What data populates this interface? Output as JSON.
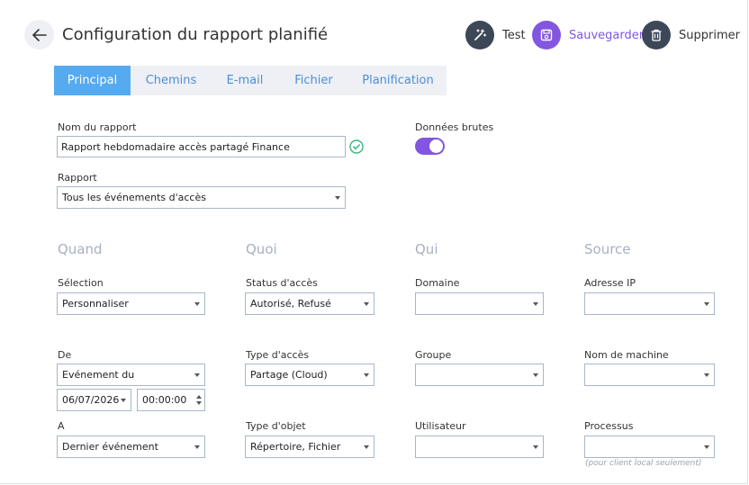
{
  "header": {
    "title": "Configuration du rapport planifié",
    "test_label": "Test",
    "save_label": "Sauvegarder",
    "delete_label": "Supprimer"
  },
  "tabs": [
    "Principal",
    "Chemins",
    "E-mail",
    "Fichier",
    "Planification"
  ],
  "form": {
    "report_name_label": "Nom du rapport",
    "report_name_value": "Rapport hebdomadaire accès partagé Finance",
    "raw_data_label": "Données brutes",
    "raw_data_on": true,
    "report_label": "Rapport",
    "report_value": "Tous les événements d'accès"
  },
  "sections": {
    "when": "Quand",
    "what": "Quoi",
    "who": "Qui",
    "source": "Source"
  },
  "quand": {
    "selection_label": "Sélection",
    "selection_value": "Personnaliser",
    "from_label": "De",
    "from_value": "Evénement du",
    "date_value": "06/07/2026",
    "time_value": "00:00:00",
    "to_label": "A",
    "to_value": "Dernier événement"
  },
  "quoi": {
    "status_label": "Status d'accès",
    "status_value": "Autorisé, Refusé",
    "access_type_label": "Type d'accès",
    "access_type_value": "Partage (Cloud)",
    "object_type_label": "Type d'objet",
    "object_type_value": "Répertoire, Fichier"
  },
  "qui": {
    "domain_label": "Domaine",
    "domain_value": "",
    "group_label": "Groupe",
    "group_value": "",
    "user_label": "Utilisateur",
    "user_value": ""
  },
  "source": {
    "ip_label": "Adresse IP",
    "ip_value": "",
    "machine_label": "Nom de machine",
    "machine_value": "",
    "process_label": "Processus",
    "process_value": "",
    "process_note": "(pour client local seulement)"
  },
  "colors": {
    "accent_purple": "#8256e0",
    "tab_active": "#56aaf0",
    "dark_button": "#3c4758",
    "section_heading": "#a7b1c0",
    "valid_check": "#3bb77e"
  }
}
